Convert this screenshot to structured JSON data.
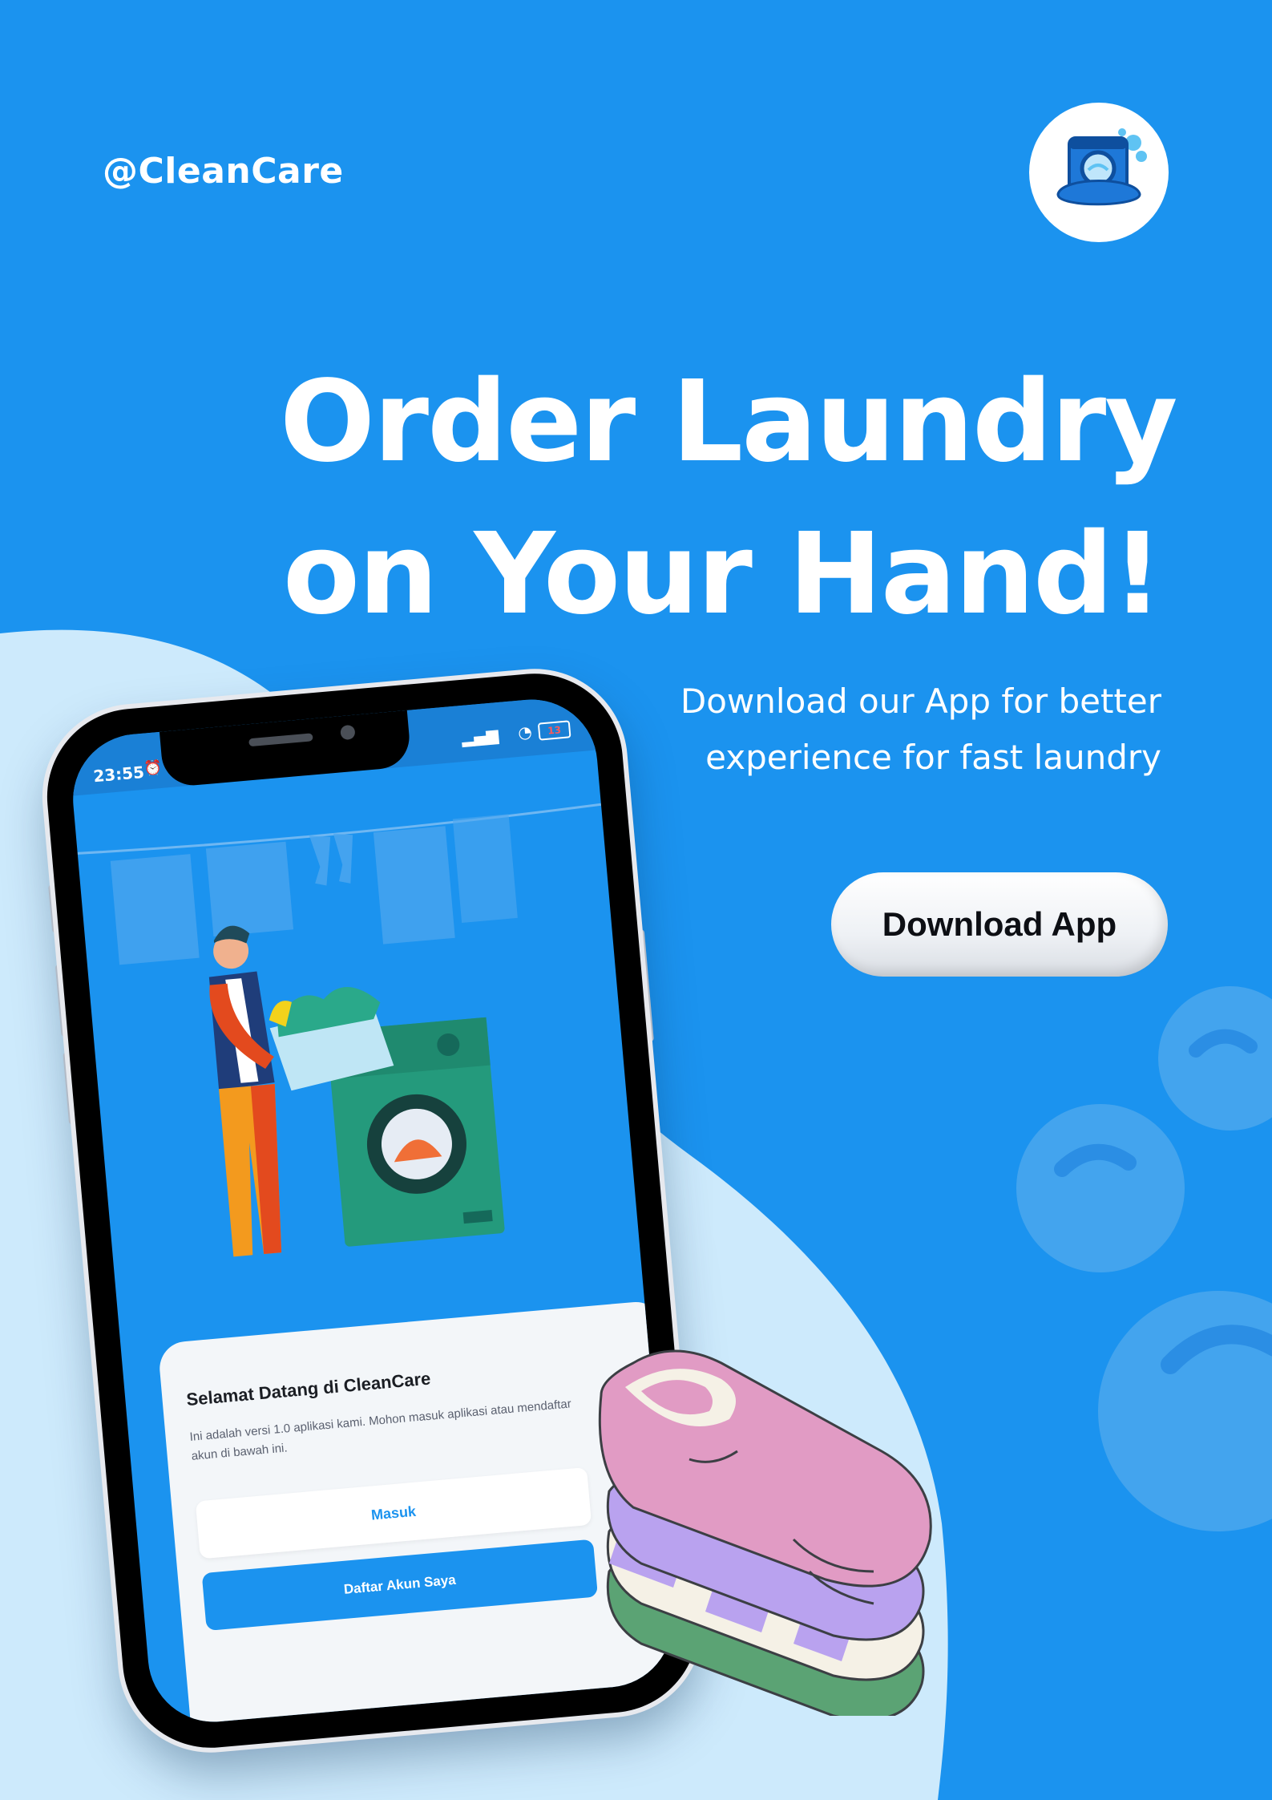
{
  "brand": {
    "handle": "@CleanCare",
    "logo_text": "CleanCare"
  },
  "headline": {
    "line1": "Order Laundry",
    "line2": "on Your Hand!"
  },
  "subtext": {
    "line1": "Download our App for better",
    "line2": "experience for fast laundry"
  },
  "cta": {
    "download_label": "Download App"
  },
  "phone": {
    "status_time": "23:55",
    "battery": "13",
    "welcome_title": "Selamat Datang di CleanCare",
    "welcome_desc": "Ini adalah versi 1.0 aplikasi kami. Mohon masuk aplikasi atau mendaftar akun di bawah ini.",
    "login_label": "Masuk",
    "register_label": "Daftar Akun Saya"
  },
  "colors": {
    "background": "#1b93ef",
    "wave": "#cdeafc",
    "bubble": "#52a9ee",
    "button": "#f3f5f8"
  },
  "icons": [
    "washing-machine-logo-icon",
    "alarm-icon",
    "whatsapp-icon",
    "signal-icon",
    "wifi-icon",
    "battery-icon",
    "smile-bubble-icon"
  ]
}
